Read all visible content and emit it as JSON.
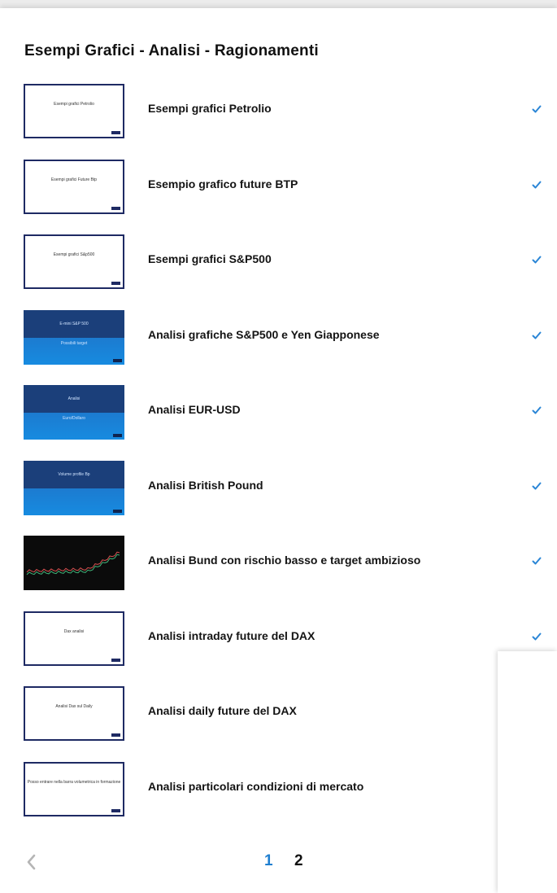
{
  "section": {
    "title": "Esempi Grafici - Analisi - Ragionamenti"
  },
  "lessons": [
    {
      "title": "Esempi grafici Petrolio",
      "thumb_style": "white",
      "thumb_text": "Esempi grafici Petrolio",
      "thumb_subtext": "",
      "completed": true
    },
    {
      "title": "Esempio grafico future BTP",
      "thumb_style": "white",
      "thumb_text": "Esempi grafici Future Btp",
      "thumb_subtext": "",
      "completed": true
    },
    {
      "title": "Esempi grafici S&P500",
      "thumb_style": "white",
      "thumb_text": "Esempi grafici S&p500",
      "thumb_subtext": "",
      "completed": true
    },
    {
      "title": "Analisi grafiche S&P500 e Yen Giapponese",
      "thumb_style": "blue",
      "thumb_text": "E-mini S&P 500",
      "thumb_subtext": "Possibili target",
      "completed": true
    },
    {
      "title": "Analisi EUR-USD",
      "thumb_style": "blue",
      "thumb_text": "Analisi",
      "thumb_subtext": "Euro/Dollaro",
      "completed": true
    },
    {
      "title": "Analisi British Pound",
      "thumb_style": "blue",
      "thumb_text": "Volume profile Bp",
      "thumb_subtext": "",
      "completed": true
    },
    {
      "title": "Analisi Bund con rischio basso e target ambizioso",
      "thumb_style": "dark",
      "thumb_text": "",
      "thumb_subtext": "",
      "completed": true
    },
    {
      "title": "Analisi intraday future del DAX",
      "thumb_style": "white",
      "thumb_text": "Dax analisi",
      "thumb_subtext": "",
      "completed": true
    },
    {
      "title": "Analisi daily future del DAX",
      "thumb_style": "white",
      "thumb_text": "Analisi Dax sul Daily",
      "thumb_subtext": "",
      "completed": false
    },
    {
      "title": "Analisi particolari condizioni di mercato",
      "thumb_style": "white",
      "thumb_text": "Posso entrare nella barra volumetrica in formazione",
      "thumb_subtext": "",
      "completed": false
    }
  ],
  "pagination": {
    "prev_icon": "chevron-left-icon",
    "pages": [
      "1",
      "2"
    ],
    "current": "1"
  },
  "colors": {
    "accent": "#1f7fd0",
    "check": "#2b86d6",
    "thumb_border": "#1e2a63",
    "thumb_blue": "#1b3f7a"
  }
}
